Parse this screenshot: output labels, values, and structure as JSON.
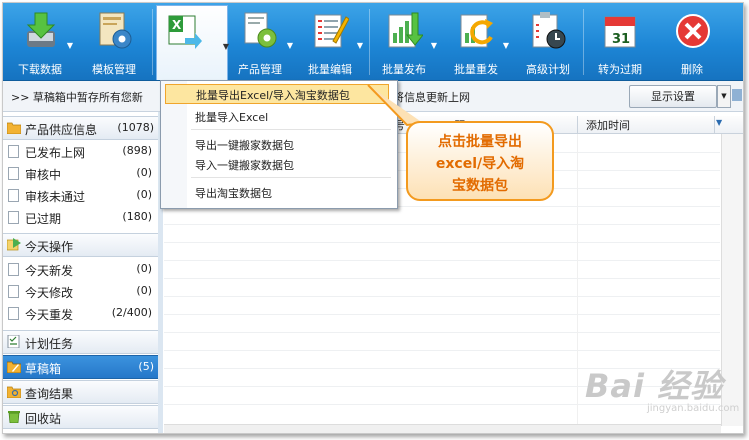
{
  "toolbar": {
    "buttons": [
      {
        "label": "下载数据"
      },
      {
        "label": "模板管理"
      },
      {
        "label": ""
      },
      {
        "label": "产品管理"
      },
      {
        "label": "批量编辑"
      },
      {
        "label": "批量发布"
      },
      {
        "label": "批量重发"
      },
      {
        "label": "高级计划"
      },
      {
        "label": "转为过期"
      },
      {
        "label": "删除"
      }
    ],
    "calendar_day": "31"
  },
  "infobar": {
    "message": ">> 草稿箱中暂存所有您新",
    "message_tail": "将信息更新上网",
    "display_settings": "显示设置"
  },
  "sidebar": {
    "groups": [
      {
        "label": "产品供应信息",
        "count": "(1078)",
        "items": [
          {
            "label": "已发布上网",
            "count": "(898)"
          },
          {
            "label": "审核中",
            "count": "(0)"
          },
          {
            "label": "审核未通过",
            "count": "(0)"
          },
          {
            "label": "已过期",
            "count": "(180)"
          }
        ]
      },
      {
        "label": "今天操作",
        "count": "",
        "items": [
          {
            "label": "今天新发",
            "count": "(0)"
          },
          {
            "label": "今天修改",
            "count": "(0)"
          },
          {
            "label": "今天重发",
            "count": "(2/400)"
          }
        ]
      }
    ],
    "singles": [
      {
        "label": "计划任务",
        "count": ""
      },
      {
        "label": "草稿箱",
        "count": "(5)"
      },
      {
        "label": "查询结果",
        "count": ""
      },
      {
        "label": "回收站",
        "count": ""
      }
    ]
  },
  "table": {
    "col_num": "号",
    "col_title": "题",
    "col_time": "添加时间"
  },
  "menu": {
    "items": [
      "批量导出Excel/导入淘宝数据包",
      "批量导入Excel",
      "导出一键搬家数据包",
      "导入一键搬家数据包",
      "导出淘宝数据包"
    ]
  },
  "callout": {
    "lines": [
      "点击批量导出",
      "excel/导入淘",
      "宝数据包"
    ]
  },
  "watermark": {
    "text": "Bai 经验",
    "sub": "jingyan.baidu.com"
  },
  "colors": {
    "toolbar": "#1d86d6",
    "highlight": "#fde6a0",
    "callout_border": "#f39a1e",
    "callout_text": "#e26b00",
    "selected": "#2677c9"
  }
}
